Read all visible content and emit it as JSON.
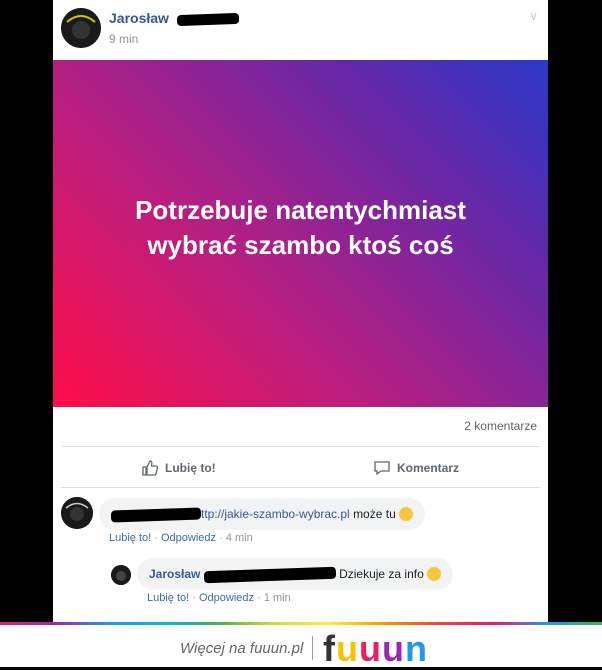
{
  "post": {
    "author": "Jarosław",
    "time": "9 min",
    "text": "Potrzebuje natentychmiast wybrać szambo ktoś coś",
    "comments_count": "2 komentarze"
  },
  "actions": {
    "like": "Lubię to!",
    "comment": "Komentarz"
  },
  "comments": [
    {
      "link": "ttp://jakie-szambo-wybrac.pl",
      "text": "może tu",
      "like": "Lubię to!",
      "reply": "Odpowiedz",
      "time": "4 min"
    },
    {
      "author": "Jarosław",
      "text": "Dziekuje za info",
      "like": "Lubię to!",
      "reply": "Odpowiedz",
      "time": "1 min"
    }
  ],
  "footer": {
    "more": "Więcej na fuuun.pl",
    "brand_letters": [
      "f",
      "u",
      "u",
      "u",
      "n"
    ]
  },
  "colors": {
    "link": "#365899",
    "muted": "#90949c",
    "brand_f": "#333333",
    "brand_u1": "#f5c400",
    "brand_u2": "#e91e63",
    "brand_u3": "#9c27b0",
    "brand_n": "#2196f3"
  }
}
